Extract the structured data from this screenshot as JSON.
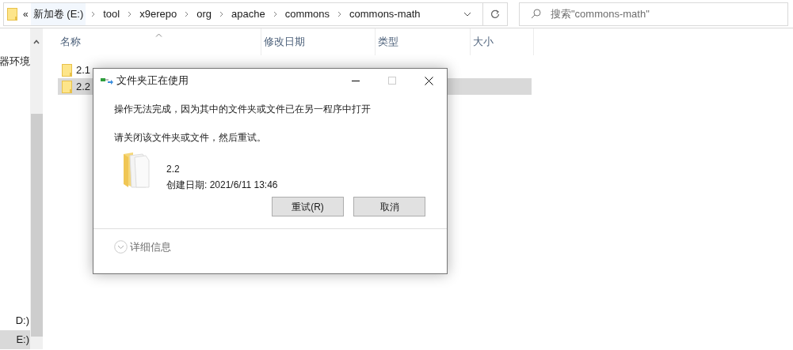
{
  "address_bar": {
    "overflow": "«",
    "crumbs": [
      {
        "label": "新加卷 (E:)",
        "selected": true
      },
      {
        "label": "tool",
        "selected": false
      },
      {
        "label": "x9erepo",
        "selected": false
      },
      {
        "label": "org",
        "selected": false
      },
      {
        "label": "apache",
        "selected": false
      },
      {
        "label": "commons",
        "selected": false
      },
      {
        "label": "commons-math",
        "selected": false
      }
    ]
  },
  "search": {
    "placeholder": "搜索\"commons-math\""
  },
  "sidebar": {
    "items": [
      {
        "label": "器环境",
        "selected": false
      },
      {
        "label": "D:)",
        "selected": false
      },
      {
        "label": "E:)",
        "selected": true
      }
    ]
  },
  "table": {
    "columns": [
      "名称",
      "修改日期",
      "类型",
      "大小"
    ],
    "rows": [
      {
        "name": "2.1",
        "selected": false
      },
      {
        "name": "2.2",
        "selected": true
      }
    ]
  },
  "dialog": {
    "title": "文件夹正在使用",
    "message": "操作无法完成，因为其中的文件夹或文件已在另一程序中打开",
    "hint": "请关闭该文件夹或文件，然后重试。",
    "item": {
      "name": "2.2",
      "created": "创建日期: 2021/6/11 13:46"
    },
    "buttons": [
      "重试(R)",
      "取消"
    ],
    "details": "详细信息"
  }
}
